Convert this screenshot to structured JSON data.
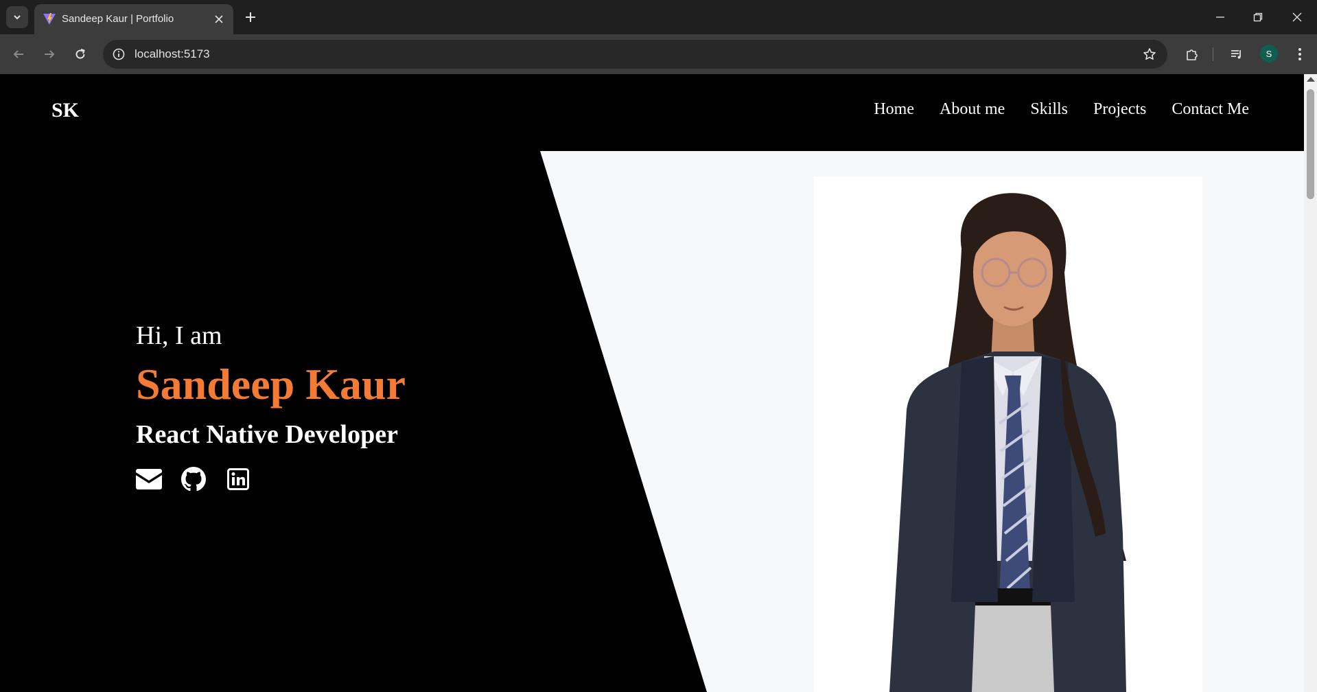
{
  "browser": {
    "tab_title": "Sandeep Kaur | Portfolio",
    "url": "localhost:5173",
    "profile_initial": "S"
  },
  "site": {
    "logo": "SK",
    "nav": [
      "Home",
      "About me",
      "Skills",
      "Projects",
      "Contact Me"
    ],
    "hero": {
      "greeting": "Hi, I am",
      "name": "Sandeep Kaur",
      "role": "React Native Developer"
    },
    "socials": [
      "envelope-icon",
      "github-icon",
      "linkedin-icon"
    ]
  },
  "colors": {
    "accent": "#f47b35",
    "page_bg": "#000000",
    "panel_bg": "#f7f8fa"
  }
}
